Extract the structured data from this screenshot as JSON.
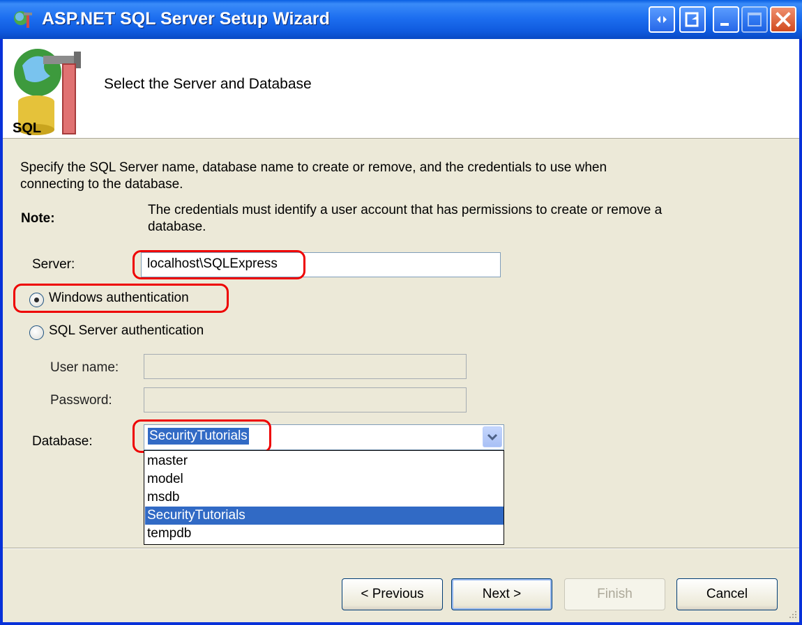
{
  "window": {
    "title": "ASP.NET SQL Server Setup Wizard"
  },
  "header": {
    "title": "Select the Server and Database",
    "logo_text": "SQL"
  },
  "body": {
    "description": "Specify the SQL Server name, database name to create or remove, and the credentials to use when connecting to the database.",
    "description_line1": "Specify the SQL Server name, database name to create or remove, and the credentials to use when",
    "description_line2": "connecting to the database.",
    "note_label": "Note:",
    "note_line1": "The credentials must identify a user account that has permissions to create or remove a",
    "note_line2": "database."
  },
  "form": {
    "server_label": "Server:",
    "server_value": "localhost\\SQLExpress",
    "windows_auth_label": "Windows authentication",
    "windows_auth_selected": true,
    "sql_auth_label": "SQL Server authentication",
    "sql_auth_selected": false,
    "username_label": "User name:",
    "username_value": "",
    "password_label": "Password:",
    "password_value": "",
    "database_label": "Database:",
    "database_value": "SecurityTutorials",
    "database_options": [
      "master",
      "model",
      "msdb",
      "SecurityTutorials",
      "tempdb"
    ],
    "database_selected_index": 3
  },
  "buttons": {
    "previous": "< Previous",
    "next": "Next >",
    "finish": "Finish",
    "cancel": "Cancel"
  },
  "colors": {
    "titlebar": "#0a5fe3",
    "highlight": "#ee0000",
    "selection": "#316ac5",
    "dialog_bg": "#ece9d8"
  }
}
